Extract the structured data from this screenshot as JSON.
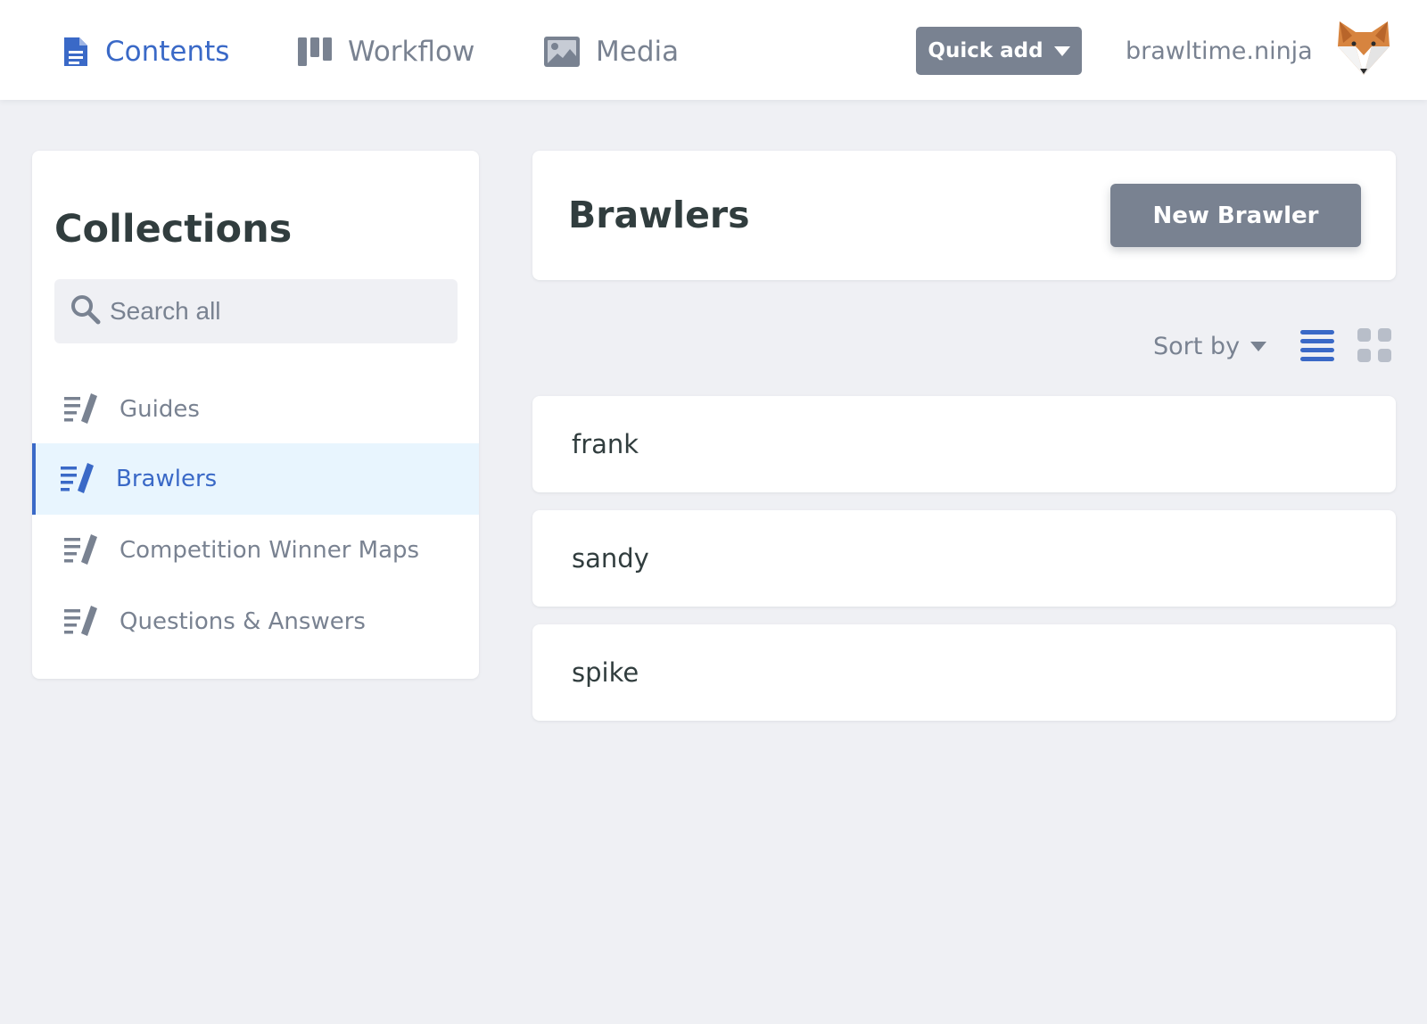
{
  "topbar": {
    "nav": [
      {
        "label": "Contents",
        "icon": "document-icon",
        "active": true
      },
      {
        "label": "Workflow",
        "icon": "workflow-icon",
        "active": false
      },
      {
        "label": "Media",
        "icon": "image-icon",
        "active": false
      }
    ],
    "quick_add_label": "Quick add",
    "site_name": "brawltime.ninja",
    "avatar_icon": "fox-avatar"
  },
  "sidebar": {
    "title": "Collections",
    "search_placeholder": "Search all",
    "items": [
      {
        "label": "Guides",
        "icon": "collection-icon",
        "active": false
      },
      {
        "label": "Brawlers",
        "icon": "collection-icon",
        "active": true
      },
      {
        "label": "Competition Winner Maps",
        "icon": "collection-icon",
        "active": false
      },
      {
        "label": "Questions & Answers",
        "icon": "collection-icon",
        "active": false
      }
    ]
  },
  "main": {
    "title": "Brawlers",
    "new_button_label": "New Brawler",
    "sort_label": "Sort by",
    "view_modes": [
      "list-view-icon",
      "grid-view-icon"
    ],
    "active_view": "list",
    "entries": [
      "frank",
      "sandy",
      "spike"
    ]
  },
  "colors": {
    "accent": "#3a69c7",
    "muted": "#798291",
    "background": "#eff0f4",
    "active_item_bg": "#e8f5fe"
  }
}
